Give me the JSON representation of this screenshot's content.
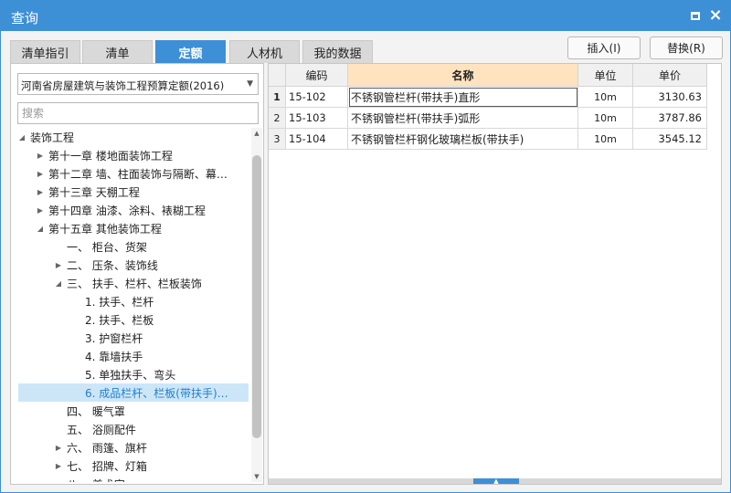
{
  "window": {
    "title": "查询"
  },
  "tabs": [
    {
      "label": "清单指引",
      "active": false
    },
    {
      "label": "清单",
      "active": false
    },
    {
      "label": "定额",
      "active": true
    },
    {
      "label": "人材机",
      "active": false
    },
    {
      "label": "我的数据",
      "active": false
    }
  ],
  "buttons": {
    "insert": "插入(I)",
    "replace": "替换(R)"
  },
  "quota_select": {
    "value": "河南省房屋建筑与装饰工程预算定额(2016)"
  },
  "search": {
    "placeholder": "搜索"
  },
  "tree": [
    {
      "label": "装饰工程",
      "toggle": "expanded",
      "depth": 0
    },
    {
      "label": "第十一章  楼地面装饰工程",
      "toggle": "collapsed",
      "depth": 1
    },
    {
      "label": "第十二章  墙、柱面装饰与隔断、幕…",
      "toggle": "collapsed",
      "depth": 1
    },
    {
      "label": "第十三章  天棚工程",
      "toggle": "collapsed",
      "depth": 1
    },
    {
      "label": "第十四章  油漆、涂料、裱糊工程",
      "toggle": "collapsed",
      "depth": 1
    },
    {
      "label": "第十五章  其他装饰工程",
      "toggle": "expanded",
      "depth": 1
    },
    {
      "label": "一、  柜台、货架",
      "toggle": "none",
      "depth": 2
    },
    {
      "label": "二、  压条、装饰线",
      "toggle": "collapsed",
      "depth": 2
    },
    {
      "label": "三、  扶手、栏杆、栏板装饰",
      "toggle": "expanded",
      "depth": 2
    },
    {
      "label": "1.  扶手、栏杆",
      "toggle": "none",
      "depth": 3
    },
    {
      "label": "2.  扶手、栏板",
      "toggle": "none",
      "depth": 3
    },
    {
      "label": "3.  护窗栏杆",
      "toggle": "none",
      "depth": 3
    },
    {
      "label": "4.  靠墙扶手",
      "toggle": "none",
      "depth": 3
    },
    {
      "label": "5.  单独扶手、弯头",
      "toggle": "none",
      "depth": 3
    },
    {
      "label": "6.  成品栏杆、栏板(带扶手)…",
      "toggle": "none",
      "depth": 3,
      "selected": true
    },
    {
      "label": "四、  暖气罩",
      "toggle": "none",
      "depth": 2
    },
    {
      "label": "五、  浴厕配件",
      "toggle": "none",
      "depth": 2
    },
    {
      "label": "六、  雨篷、旗杆",
      "toggle": "collapsed",
      "depth": 2
    },
    {
      "label": "七、  招牌、灯箱",
      "toggle": "collapsed",
      "depth": 2
    },
    {
      "label": "八、  美术字",
      "toggle": "none",
      "depth": 2
    }
  ],
  "grid": {
    "columns": [
      "编码",
      "名称",
      "单位",
      "单价"
    ],
    "active_column": 1,
    "rows": [
      {
        "no": "1",
        "code": "15-102",
        "name": "不锈钢管栏杆(带扶手)直形",
        "unit": "10m",
        "price": "3130.63"
      },
      {
        "no": "2",
        "code": "15-103",
        "name": "不锈钢管栏杆(带扶手)弧形",
        "unit": "10m",
        "price": "3787.86"
      },
      {
        "no": "3",
        "code": "15-104",
        "name": "不锈钢管栏杆钢化玻璃栏板(带扶手)",
        "unit": "10m",
        "price": "3545.12"
      }
    ]
  },
  "colors": {
    "accent": "#3d8fd6",
    "selected_bg": "#cde6f7",
    "header_active": "#ffe3bf"
  }
}
